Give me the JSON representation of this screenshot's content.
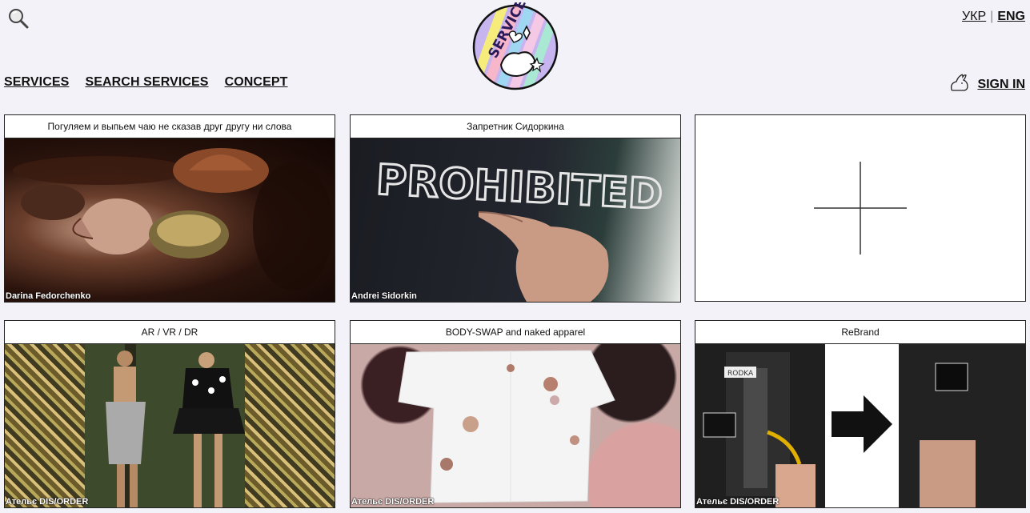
{
  "header": {
    "logo_text": "SERVICE",
    "lang": {
      "ukr": "УКР",
      "separator": "|",
      "eng": "ENG"
    }
  },
  "nav": {
    "items": [
      {
        "label": "SERVICES"
      },
      {
        "label": "SEARCH SERVICES"
      },
      {
        "label": "CONCEPT"
      }
    ],
    "sign_in": "SIGN IN"
  },
  "cards": [
    {
      "title": "Погуляем и выпьем чаю не сказав друг другу ни слова",
      "author": "Darina Fedorchenko"
    },
    {
      "title": "Запретник Сидоркина",
      "author": "Andrei Sidorkin",
      "shirt_text": "PROHIBITED"
    },
    {
      "title": "AR / VR / DR",
      "author": "Ательє DIS/ORDER"
    },
    {
      "title": "BODY-SWAP and naked apparel",
      "author": "Ательє DIS/ORDER"
    },
    {
      "title": "ReBrand",
      "author": "Ательє DIS/ORDER",
      "label_text": "RODKA"
    }
  ],
  "colors": {
    "background": "#f3f2f8",
    "border": "#222222",
    "text": "#111111"
  }
}
